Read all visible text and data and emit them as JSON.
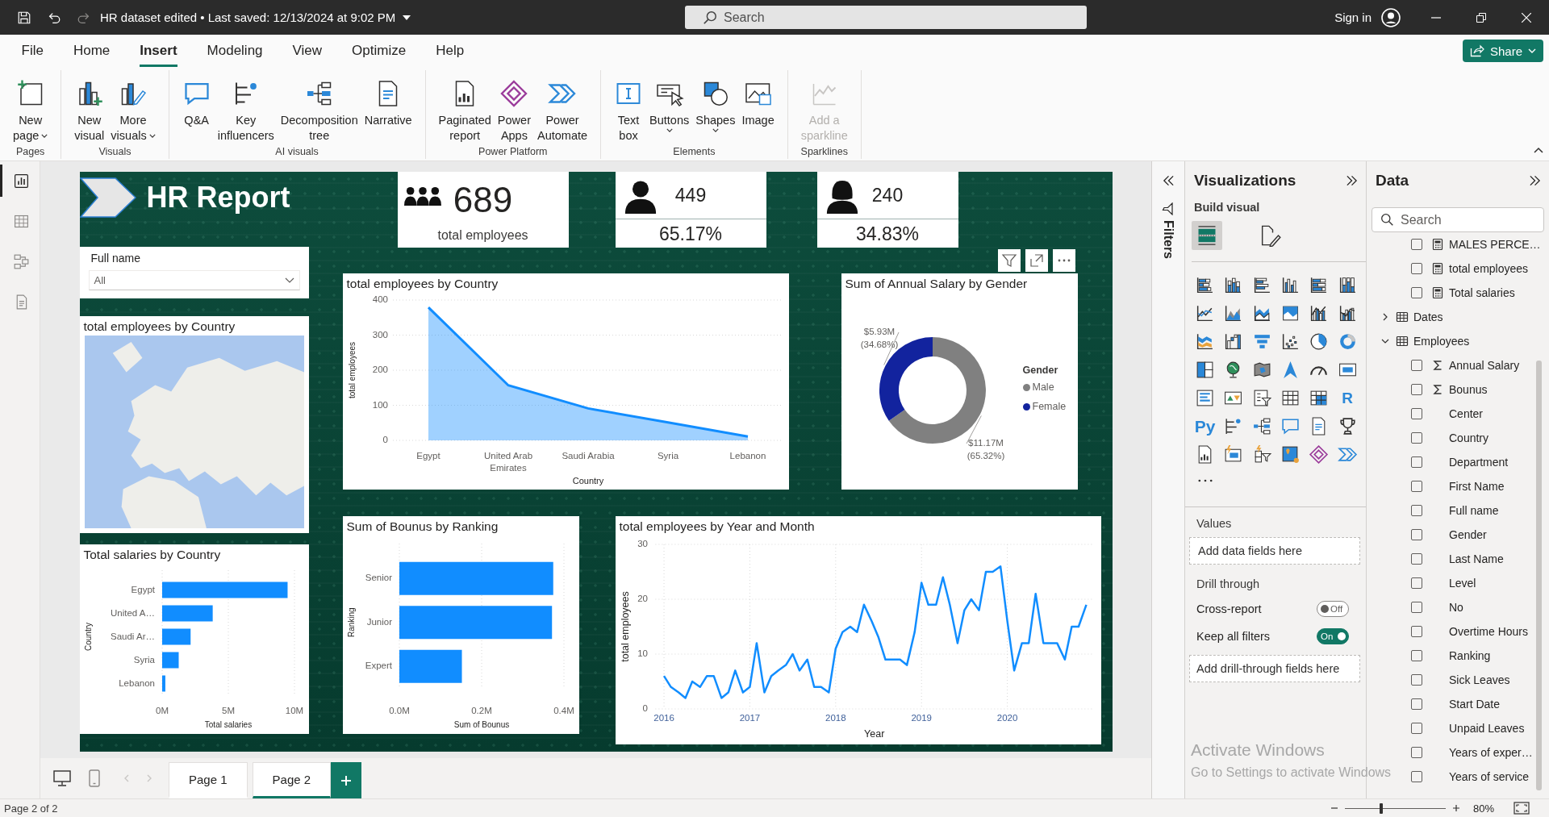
{
  "title_bar": {
    "quick_access": [
      {
        "kind": "save",
        "disabled": false
      },
      {
        "kind": "undo",
        "disabled": false
      },
      {
        "kind": "redo",
        "disabled": true
      }
    ],
    "document_title": "HR dataset edited • Last saved: 12/13/2024 at 9:02 PM",
    "search": {
      "placeholder": "Search"
    },
    "sign_in": "Sign in"
  },
  "menu_tabs": [
    {
      "label": "File",
      "selected": false
    },
    {
      "label": "Home",
      "selected": false
    },
    {
      "label": "Insert",
      "selected": true
    },
    {
      "label": "Modeling",
      "selected": false
    },
    {
      "label": "View",
      "selected": false
    },
    {
      "label": "Optimize",
      "selected": false
    },
    {
      "label": "Help",
      "selected": false
    }
  ],
  "share_button": {
    "label": "Share"
  },
  "ribbon": {
    "groups": [
      {
        "label": "Pages",
        "buttons": [
          {
            "kind": "new_page",
            "lines": [
              "New",
              "page"
            ],
            "dropdown": true,
            "disabled": false
          }
        ]
      },
      {
        "label": "Visuals",
        "buttons": [
          {
            "kind": "new_visual",
            "lines": [
              "New",
              "visual"
            ],
            "dropdown": false,
            "disabled": false
          },
          {
            "kind": "more_visuals",
            "lines": [
              "More",
              "visuals"
            ],
            "dropdown": true,
            "disabled": false
          }
        ]
      },
      {
        "label": "AI visuals",
        "buttons": [
          {
            "kind": "qa",
            "lines": [
              "Q&A"
            ],
            "dropdown": false,
            "disabled": false
          },
          {
            "kind": "key_influencers",
            "lines": [
              "Key",
              "influencers"
            ],
            "dropdown": false,
            "disabled": false
          },
          {
            "kind": "decomposition_tree",
            "lines": [
              "Decomposition",
              "tree"
            ],
            "dropdown": false,
            "disabled": false
          },
          {
            "kind": "narrative",
            "lines": [
              "Narrative"
            ],
            "dropdown": false,
            "disabled": false
          }
        ]
      },
      {
        "label": "Power Platform",
        "buttons": [
          {
            "kind": "paginated_report",
            "lines": [
              "Paginated",
              "report"
            ],
            "dropdown": false,
            "disabled": false
          },
          {
            "kind": "power_apps",
            "lines": [
              "Power",
              "Apps"
            ],
            "dropdown": false,
            "disabled": false
          },
          {
            "kind": "power_automate",
            "lines": [
              "Power",
              "Automate"
            ],
            "dropdown": false,
            "disabled": false
          }
        ]
      },
      {
        "label": "Elements",
        "buttons": [
          {
            "kind": "text_box",
            "lines": [
              "Text",
              "box"
            ],
            "dropdown": false,
            "disabled": false
          },
          {
            "kind": "buttons",
            "lines": [
              "Buttons"
            ],
            "dropdown": true,
            "disabled": false
          },
          {
            "kind": "shapes",
            "lines": [
              "Shapes"
            ],
            "dropdown": true,
            "disabled": false
          },
          {
            "kind": "image",
            "lines": [
              "Image"
            ],
            "dropdown": false,
            "disabled": false
          }
        ]
      },
      {
        "label": "Sparklines",
        "buttons": [
          {
            "kind": "sparkline",
            "lines": [
              "Add a",
              "sparkline"
            ],
            "dropdown": false,
            "disabled": true
          }
        ]
      }
    ]
  },
  "view_switcher": [
    {
      "kind": "report",
      "selected": true
    },
    {
      "kind": "table",
      "selected": false
    },
    {
      "kind": "model",
      "selected": false
    },
    {
      "kind": "dax",
      "selected": false
    }
  ],
  "report": {
    "title": "HR Report",
    "kpis": [
      {
        "kind": "group",
        "value": "689",
        "caption": "total employees"
      },
      {
        "kind": "male",
        "value": "449",
        "caption": "65.17%"
      },
      {
        "kind": "female",
        "value": "240",
        "caption": "34.83%"
      }
    ],
    "slicer": {
      "title": "Full name",
      "value": "All"
    },
    "visuals": [
      {
        "kind": "map",
        "title": "total employees by Country"
      },
      {
        "kind": "chart",
        "title": "total employees by Country",
        "chart_data": {
          "type": "area",
          "xlabel": "Country",
          "ylabel": "total employees",
          "categories": [
            "Egypt",
            "United Arab Emirates",
            "Saudi Arabia",
            "Syria",
            "Lebanon"
          ],
          "series": [
            {
              "color": "#118dff",
              "values": [
                379,
                157,
                91,
                51,
                11
              ]
            }
          ],
          "ylim": [
            0,
            400
          ],
          "yticks": [
            0,
            100,
            200,
            300,
            400
          ],
          "grid": true
        }
      },
      {
        "kind": "chart",
        "title": "Sum of Annual Salary by Gender",
        "toolbar_shown": true,
        "chart_data": {
          "type": "donut",
          "categories": [
            "Male",
            "Female"
          ],
          "values": [
            65.32,
            34.68
          ],
          "value_labels": [
            "$11.17M (65.32%)",
            "$5.93M (34.68%)"
          ]
        },
        "legend": {
          "title": "Gender",
          "items": [
            {
              "color": "#808080"
            },
            {
              "color": "#12239e"
            }
          ]
        }
      },
      {
        "kind": "chart",
        "title": "Total salaries by Country",
        "chart_data": {
          "type": "bar",
          "orientation": "horizontal",
          "xlabel": "Total salaries",
          "ylabel": "Country",
          "categories": [
            "Egypt",
            "United A…",
            "Saudi Ar…",
            "Syria",
            "Lebanon"
          ],
          "series": [
            {
              "color": "#118dff",
              "values": [
                9.48,
                3.82,
                2.15,
                1.25,
                0.24
              ]
            }
          ],
          "xlim": [
            0,
            10
          ],
          "xticks": [
            {
              "value": 0,
              "label": "0M"
            },
            {
              "value": 5,
              "label": "5M"
            },
            {
              "value": 10,
              "label": "10M"
            }
          ],
          "grid": true
        }
      },
      {
        "kind": "chart",
        "title": "Sum of Bounus by Ranking",
        "chart_data": {
          "type": "bar",
          "orientation": "horizontal",
          "xlabel": "Sum of Bounus",
          "ylabel": "Ranking",
          "categories": [
            "Senior",
            "Junior",
            "Expert"
          ],
          "series": [
            {
              "color": "#118dff",
              "values": [
                0.374,
                0.371,
                0.152
              ]
            }
          ],
          "xlim": [
            0,
            0.4
          ],
          "xticks": [
            {
              "value": 0,
              "label": "0.0M"
            },
            {
              "value": 0.2,
              "label": "0.2M"
            },
            {
              "value": 0.4,
              "label": "0.4M"
            }
          ],
          "grid": true
        }
      },
      {
        "kind": "chart",
        "title": "total employees by Year and Month",
        "chart_data": {
          "type": "line",
          "xlabel": "Year",
          "ylabel": "total employees",
          "x": [
            2016,
            2016.08,
            2016.17,
            2016.25,
            2016.33,
            2016.42,
            2016.5,
            2016.58,
            2016.67,
            2016.75,
            2016.83,
            2016.92,
            2017,
            2017.08,
            2017.17,
            2017.25,
            2017.33,
            2017.42,
            2017.5,
            2017.58,
            2017.67,
            2017.75,
            2017.83,
            2017.92,
            2018,
            2018.08,
            2018.17,
            2018.25,
            2018.33,
            2018.42,
            2018.5,
            2018.58,
            2018.67,
            2018.75,
            2018.83,
            2018.92,
            2019,
            2019.08,
            2019.17,
            2019.25,
            2019.33,
            2019.42,
            2019.5,
            2019.58,
            2019.67,
            2019.75,
            2019.83,
            2019.92,
            2020,
            2020.08,
            2020.17,
            2020.25,
            2020.33,
            2020.42,
            2020.5,
            2020.58,
            2020.67,
            2020.75,
            2020.83,
            2020.92
          ],
          "series": [
            {
              "color": "#118dff",
              "values": [
                6,
                4,
                3,
                2,
                5,
                4,
                6,
                6,
                2,
                3,
                7,
                3,
                4,
                12,
                3,
                6,
                7,
                8,
                10,
                7,
                9,
                4,
                4,
                3,
                11,
                14,
                15,
                14,
                19,
                16,
                13,
                9,
                9,
                9,
                8,
                14,
                23,
                19,
                19,
                24,
                19,
                12,
                18,
                20,
                18,
                25,
                25,
                26,
                16,
                7,
                12,
                12,
                21,
                12,
                12,
                12,
                9,
                15,
                15,
                19
              ]
            }
          ],
          "xlim": [
            2015.9,
            2021
          ],
          "ylim": [
            0,
            30
          ],
          "xticks": [
            2016,
            2017,
            2018,
            2019,
            2020
          ],
          "yticks": [
            0,
            10,
            20,
            30
          ],
          "grid": true
        }
      }
    ]
  },
  "filters_pane": {
    "label": "Filters"
  },
  "visualizations_pane": {
    "title": "Visualizations",
    "section": "Build visual",
    "modes": [
      {
        "kind": "build",
        "selected": true
      },
      {
        "kind": "format",
        "selected": false
      }
    ],
    "gallery_glyphs": [
      "R",
      "Py"
    ],
    "values_well": {
      "label": "Values",
      "placeholder": "Add data fields here"
    },
    "drill_through": {
      "title": "Drill through",
      "toggles": [
        {
          "label": "Cross-report",
          "on": false,
          "state_text": "Off"
        },
        {
          "label": "Keep all filters",
          "on": true,
          "state_text": "On"
        }
      ],
      "placeholder": "Add drill-through fields here"
    }
  },
  "data_pane": {
    "title": "Data",
    "search": {
      "placeholder": "Search"
    },
    "items": [
      {
        "label": "MALES PERCE…",
        "kind": "measure",
        "checked": false
      },
      {
        "label": "total employees",
        "kind": "measure",
        "checked": false
      },
      {
        "label": "Total salaries",
        "kind": "measure",
        "checked": false
      },
      {
        "label": "Dates",
        "kind": "table",
        "expanded": false
      },
      {
        "label": "Employees",
        "kind": "table",
        "expanded": true,
        "children": [
          {
            "label": "Annual Salary",
            "kind": "sum",
            "checked": false
          },
          {
            "label": "Bounus",
            "kind": "sum",
            "checked": false
          },
          {
            "label": "Center",
            "kind": "field",
            "checked": false
          },
          {
            "label": "Country",
            "kind": "field",
            "checked": false
          },
          {
            "label": "Department",
            "kind": "field",
            "checked": false
          },
          {
            "label": "First Name",
            "kind": "field",
            "checked": false
          },
          {
            "label": "Full name",
            "kind": "field",
            "checked": false
          },
          {
            "label": "Gender",
            "kind": "field",
            "checked": false
          },
          {
            "label": "Last Name",
            "kind": "field",
            "checked": false
          },
          {
            "label": "Level",
            "kind": "field",
            "checked": false
          },
          {
            "label": "No",
            "kind": "field",
            "checked": false
          },
          {
            "label": "Overtime Hours",
            "kind": "field",
            "checked": false
          },
          {
            "label": "Ranking",
            "kind": "field",
            "checked": false
          },
          {
            "label": "Sick Leaves",
            "kind": "field",
            "checked": false
          },
          {
            "label": "Start Date",
            "kind": "field",
            "checked": false
          },
          {
            "label": "Unpaid Leaves",
            "kind": "field",
            "checked": false
          },
          {
            "label": "Years of exper…",
            "kind": "field",
            "checked": false
          },
          {
            "label": "Years of service",
            "kind": "field",
            "checked": false
          }
        ]
      }
    ]
  },
  "page_navigator": {
    "layouts": [
      {
        "kind": "desktop",
        "selected": true
      },
      {
        "kind": "mobile",
        "selected": false
      }
    ],
    "pages": [
      {
        "label": "Page 1",
        "selected": false
      },
      {
        "label": "Page 2",
        "selected": true
      }
    ]
  },
  "status_bar": {
    "page_info": "Page 2 of 2",
    "zoom": {
      "level": 0.36,
      "reading": "80%"
    }
  },
  "windows_activation": {
    "title": "Activate Windows",
    "message": "Go to Settings to activate Windows"
  }
}
